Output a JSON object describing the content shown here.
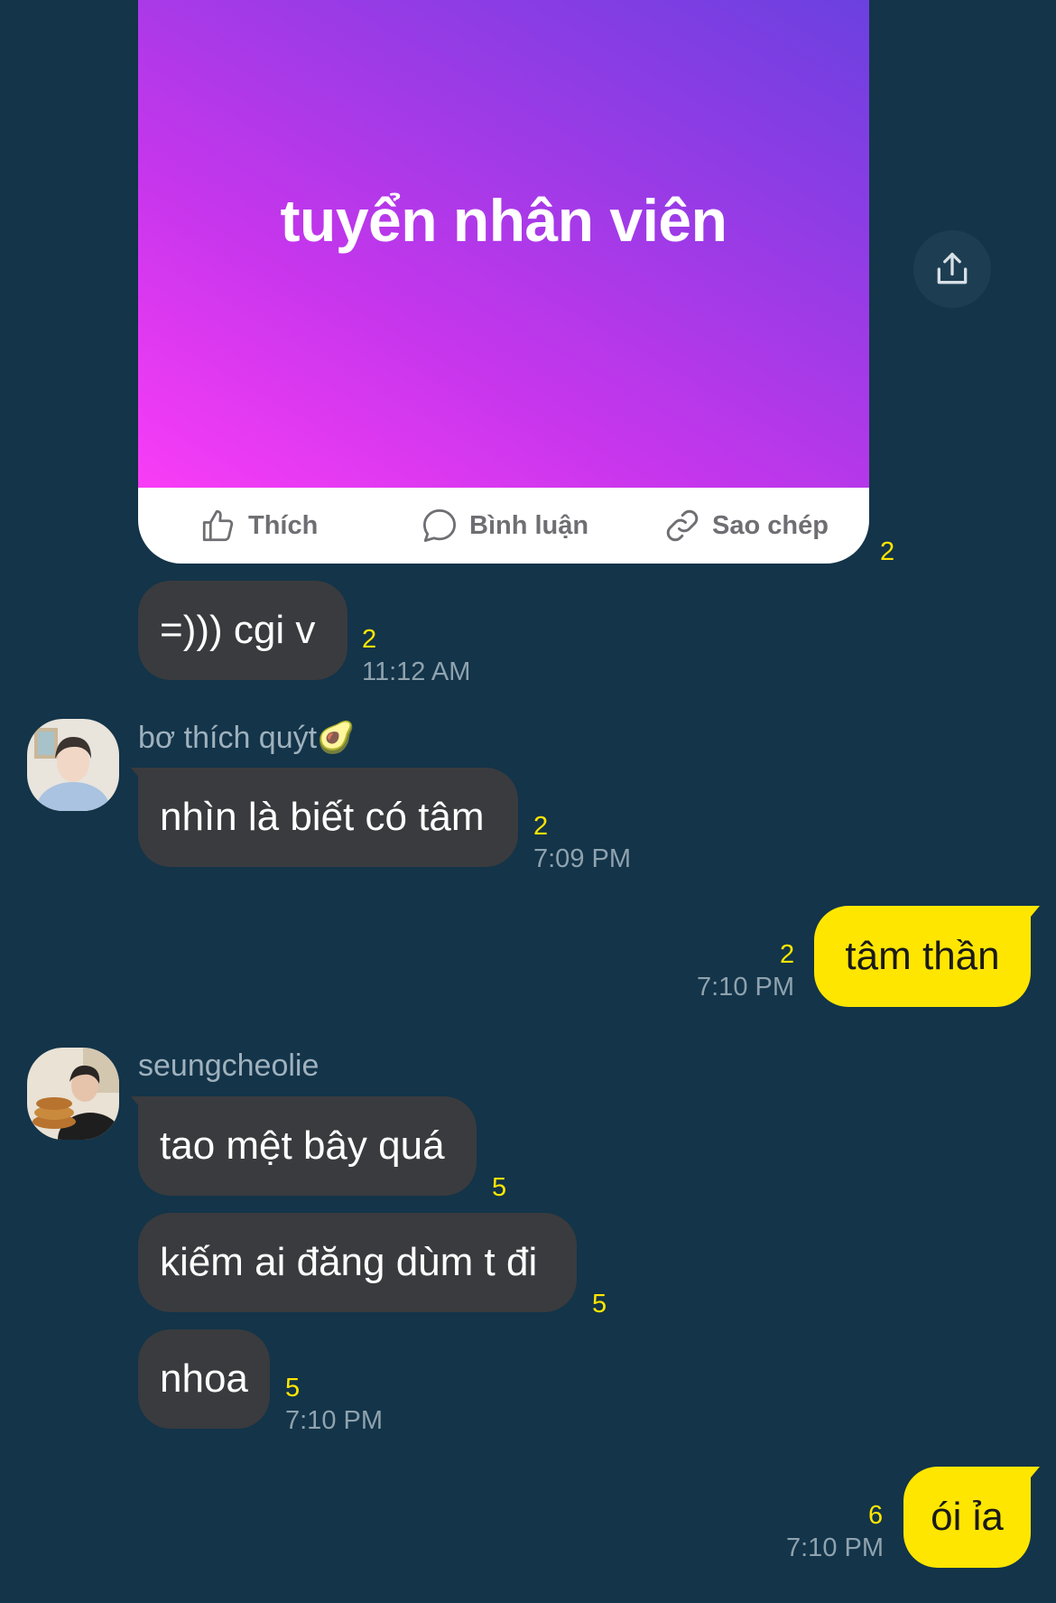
{
  "post": {
    "title": "tuyển nhân viên",
    "actions": {
      "like": "Thích",
      "comment": "Bình luận",
      "copy": "Sao chép"
    },
    "read_count": "2"
  },
  "messages": [
    {
      "text": "=))) cgi v",
      "count": "2",
      "time": "11:12 AM"
    },
    {
      "sender": "bơ thích quýt🥑",
      "text": "nhìn là biết có tâm",
      "count": "2",
      "time": "7:09 PM"
    },
    {
      "text": "tâm thần",
      "count": "2",
      "time": "7:10 PM"
    },
    {
      "sender": "seungcheolie",
      "text": "tao mệt bây quá",
      "count": "5"
    },
    {
      "text": "kiếm ai đăng dùm t đi",
      "count": "5"
    },
    {
      "text": "nhoa",
      "count": "5",
      "time": "7:10 PM"
    },
    {
      "text": "ói ỉa",
      "count": "6",
      "time": "7:10 PM"
    }
  ]
}
